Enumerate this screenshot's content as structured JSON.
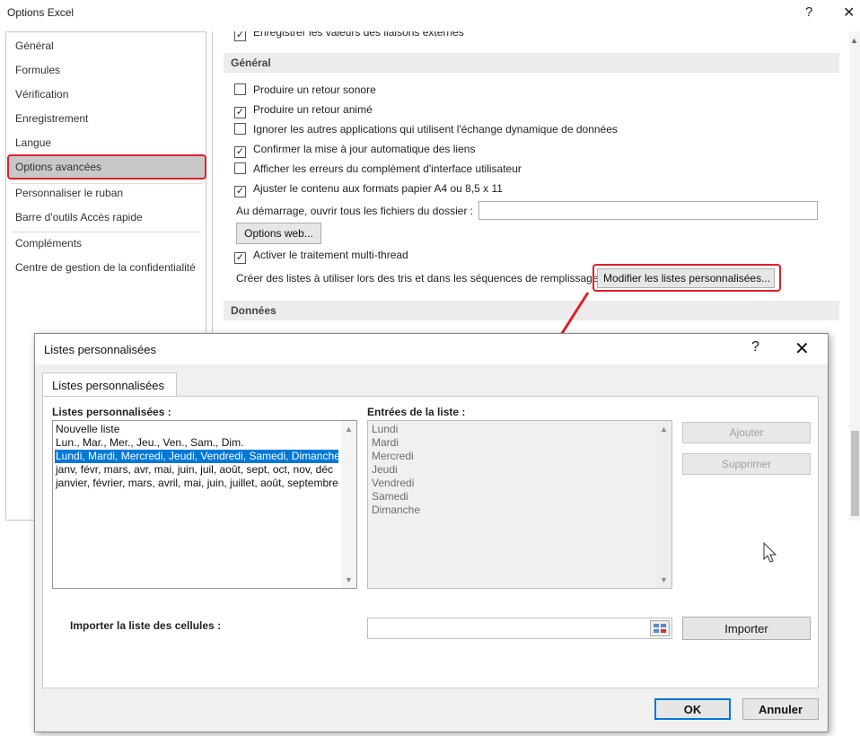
{
  "window": {
    "title": "Options Excel",
    "help_glyph": "?",
    "close_glyph": "✕"
  },
  "sidebar": {
    "items": [
      {
        "label": "Général"
      },
      {
        "label": "Formules"
      },
      {
        "label": "Vérification"
      },
      {
        "label": "Enregistrement"
      },
      {
        "label": "Langue"
      },
      {
        "label": "Options avancées"
      },
      {
        "label": "Personnaliser le ruban"
      },
      {
        "label": "Barre d'outils Accès rapide"
      },
      {
        "label": "Compléments"
      },
      {
        "label": "Centre de gestion de la confidentialité"
      }
    ]
  },
  "content": {
    "top_truncated": "Enregistrer les valeurs des liaisons externes",
    "section_general": "Général",
    "checkboxes": [
      {
        "label": "Produire un retour sonore",
        "checked": false
      },
      {
        "label": "Produire un retour animé",
        "checked": true
      },
      {
        "label": "Ignorer les autres applications qui utilisent l'échange dynamique de données",
        "checked": false
      },
      {
        "label": "Confirmer la mise à jour automatique des liens",
        "checked": true
      },
      {
        "label": "Afficher les erreurs du complément d'interface utilisateur",
        "checked": false
      },
      {
        "label": "Ajuster le contenu aux formats papier A4 ou 8,5 x 11",
        "checked": true
      }
    ],
    "startup_label": "Au démarrage, ouvrir tous les fichiers du dossier :",
    "startup_value": "",
    "web_options_button": "Options web...",
    "multithread_label": "Activer le traitement multi-thread",
    "multithread_checked": true,
    "custom_lists_label": "Créer des listes à utiliser lors des tris et dans les séquences de remplissage :",
    "custom_lists_button": "Modifier les listes personnalisées...",
    "section_data": "Données"
  },
  "dialog": {
    "title": "Listes personnalisées",
    "help_glyph": "?",
    "close_glyph": "✕",
    "tab_label": "Listes personnalisées",
    "lists_label": "Listes personnalisées :",
    "lists": [
      "Nouvelle liste",
      "Lun., Mar., Mer., Jeu., Ven., Sam., Dim.",
      "Lundi, Mardi, Mercredi, Jeudi, Vendredi, Samedi, Dimanche",
      "janv, févr, mars, avr, mai, juin, juil, août, sept, oct, nov, déc",
      "janvier, février, mars, avril, mai, juin, juillet, août, septembre, octobre, novembre, décembre"
    ],
    "selected_index": 2,
    "entries_label": "Entrées de la liste :",
    "entries": [
      "Lundi",
      "Mardi",
      "Mercredi",
      "Jeudi",
      "Vendredi",
      "Samedi",
      "Dimanche"
    ],
    "add_button": "Ajouter",
    "delete_button": "Supprimer",
    "import_label": "Importer la liste des cellules :",
    "import_value": "",
    "import_button": "Importer",
    "ok_button": "OK",
    "cancel_button": "Annuler"
  },
  "colors": {
    "accent_red": "#e0202a",
    "selection_blue": "#0078d7"
  }
}
